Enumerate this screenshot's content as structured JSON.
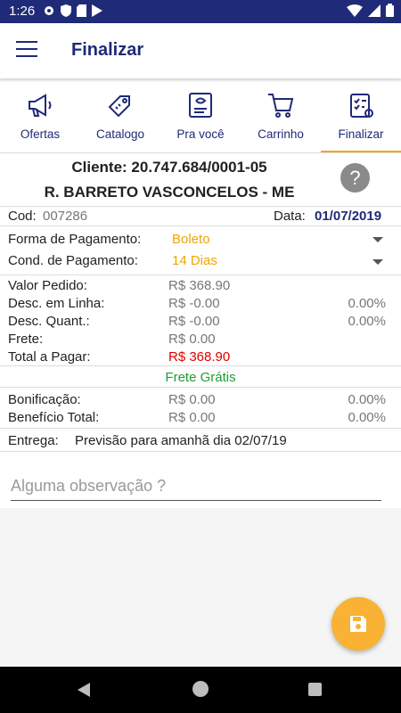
{
  "status": {
    "time": "1:26"
  },
  "appbar": {
    "title": "Finalizar"
  },
  "tabs": [
    {
      "label": "Ofertas",
      "icon": "megaphone-icon"
    },
    {
      "label": "Catalogo",
      "icon": "tag-icon"
    },
    {
      "label": "Pra você",
      "icon": "profile-card-icon"
    },
    {
      "label": "Carrinho",
      "icon": "cart-icon"
    },
    {
      "label": "Finalizar",
      "icon": "checklist-icon",
      "active": true
    }
  ],
  "client": {
    "id_text": "Cliente: 20.747.684/0001-05",
    "name": "R. BARRETO VASCONCELOS - ME",
    "help": "?"
  },
  "order": {
    "cod_label": "Cod:",
    "cod_value": "007286",
    "date_label": "Data:",
    "date_value": "01/07/2019"
  },
  "payment": {
    "method_label": "Forma de Pagamento:",
    "method_value": "Boleto",
    "cond_label": "Cond. de Pagamento:",
    "cond_value": "14 Dias"
  },
  "totals": {
    "valor_label": "Valor Pedido:",
    "valor_value": "R$ 368.90",
    "desc_linha_label": "Desc. em Linha:",
    "desc_linha_value": "R$ -0.00",
    "desc_linha_pct": "0.00%",
    "desc_quant_label": "Desc. Quant.:",
    "desc_quant_value": "R$ -0.00",
    "desc_quant_pct": "0.00%",
    "frete_label": "Frete:",
    "frete_value": "R$ 0.00",
    "total_label": "Total a Pagar:",
    "total_value": "R$ 368.90"
  },
  "frete_gratis": "Frete Grátis",
  "bonus": {
    "bonificacao_label": "Bonificação:",
    "bonificacao_value": "R$ 0.00",
    "bonificacao_pct": "0.00%",
    "beneficio_label": "Benefício Total:",
    "beneficio_value": "R$ 0.00",
    "beneficio_pct": "0.00%"
  },
  "delivery": {
    "label": "Entrega:",
    "value": "Previsão para amanhã dia 02/07/19"
  },
  "observation": {
    "placeholder": "Alguma observação ?"
  },
  "colors": {
    "primary": "#1f2a78",
    "accent": "#f5a623",
    "total": "#e00000",
    "free_shipping": "#1e9e32"
  }
}
